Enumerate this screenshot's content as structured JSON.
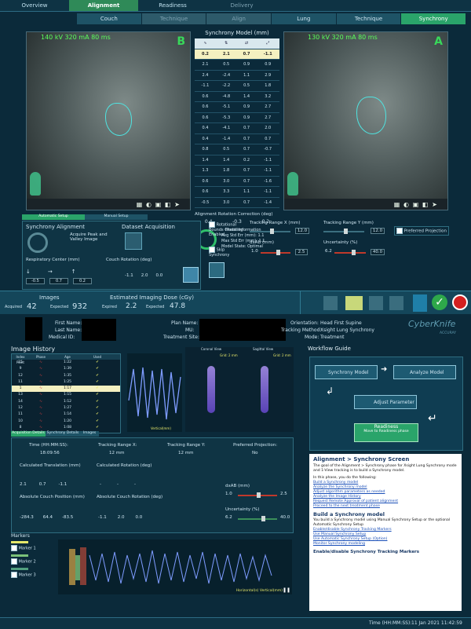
{
  "top_tabs": [
    "Overview",
    "Alignment",
    "Readiness",
    "Delivery"
  ],
  "sub_tabs": [
    "Couch",
    "Technique",
    "Align",
    "Lung",
    "Technique",
    "Synchrony"
  ],
  "left_xray": {
    "label": "140 kV 320 mA 80 ms",
    "cam": "B"
  },
  "right_xray": {
    "label": "130 kV 320 mA 80 ms",
    "cam": "A"
  },
  "sync_model": {
    "title": "Synchrony Model (mm)",
    "header": [
      "0.2",
      "2.1",
      "0.7",
      "-1.1"
    ],
    "rows": [
      [
        "2.1",
        "0.5",
        "0.9",
        "0.9"
      ],
      [
        "2.4",
        "-2.4",
        "1.1",
        "2.9"
      ],
      [
        "-1.1",
        "-2.2",
        "0.5",
        "1.8"
      ],
      [
        "0.6",
        "-4.8",
        "1.4",
        "3.2"
      ],
      [
        "0.6",
        "-5.1",
        "0.9",
        "2.7"
      ],
      [
        "0.6",
        "-5.3",
        "0.9",
        "2.7"
      ],
      [
        "0.4",
        "-4.1",
        "0.7",
        "2.0"
      ],
      [
        "0.4",
        "-1.4",
        "0.7",
        "0.7"
      ],
      [
        "0.8",
        "0.5",
        "0.7",
        "-0.7"
      ],
      [
        "1.4",
        "1.4",
        "0.2",
        "-1.1"
      ],
      [
        "1.3",
        "1.8",
        "0.7",
        "-1.1"
      ],
      [
        "0.6",
        "3.0",
        "0.7",
        "-1.6"
      ],
      [
        "0.6",
        "3.3",
        "1.1",
        "-1.1"
      ],
      [
        "-0.5",
        "3.0",
        "0.7",
        "-1.4"
      ]
    ],
    "rot_title": "Alignment Rotation Correction (deg)",
    "rot": [
      "0.4",
      "-0.3",
      "0.2"
    ],
    "mi_title": "Model Information",
    "mi": [
      [
        "Avg Std Err (mm):",
        "1.1"
      ],
      [
        "Max Std Err (mm):",
        "1.1"
      ],
      [
        "Model State:",
        "Optimal"
      ]
    ]
  },
  "setup_tabs": [
    "Automatic Setup",
    "Manual Setup"
  ],
  "sync_align": {
    "title": "Synchrony Alignment",
    "desc": "Acquire Peak and Valley Image"
  },
  "dataset": {
    "title": "Dataset Acquisition"
  },
  "resp_center": {
    "title": "Respiratory Center (mm)",
    "vals": [
      "-0.5",
      "0.7",
      "0.2"
    ]
  },
  "couch_rot": {
    "title": "Couch Rotation (deg)",
    "vals": [
      "-1.1",
      "2.0",
      "0.0"
    ]
  },
  "checks": {
    "rot_bounds": "Rotational Bounds Checking Enabled",
    "skip_sync": "Skip Synchrony"
  },
  "tracking": {
    "x_label": "Tracking Range X (mm)",
    "x_val": "12.0",
    "y_label": "Tracking Range Y (mm)",
    "y_val": "12.0",
    "pref": "Preferred Projection",
    "dxab": "dxAB (mm)",
    "dxab_min": "1.0",
    "dxab_val": "2.5",
    "unc": "Uncertainty (%)",
    "unc_min": "6.2",
    "unc_val": "40.0"
  },
  "images": {
    "title": "Images",
    "acq_label": "Acquired",
    "acq": "42",
    "exp_label": "Expected",
    "exp": "932"
  },
  "dose": {
    "title": "Estimated Imaging Dose (cGy)",
    "exp1_label": "Expired",
    "exp1": "2.2",
    "exp2_label": "Expected",
    "exp2": "47.8"
  },
  "patient": {
    "first": "First Name:",
    "last": "Last Name:",
    "mid": "Medical ID:",
    "plan": "Plan Name:",
    "mu": "MU:",
    "site": "Treatment Site:",
    "orient_l": "Orientation:",
    "orient": "Head First Supine",
    "track_l": "Tracking Method:",
    "track": "Xsight Lung Synchrony",
    "mode_l": "Mode:",
    "mode": "Treatment",
    "brand": "CyberKnife",
    "brand_sub": "ACCURAY"
  },
  "history": {
    "title": "Image History",
    "cols": [
      "Index Point",
      "Phase",
      "Age",
      "Used"
    ],
    "rows": [
      [
        "15",
        "1:22"
      ],
      [
        "9",
        "1:39"
      ],
      [
        "12",
        "1:35"
      ],
      [
        "11",
        "1:25"
      ],
      [
        "1",
        "1:17"
      ],
      [
        "13",
        "1:15"
      ],
      [
        "14",
        "1:12"
      ],
      [
        "12",
        "1:27"
      ],
      [
        "11",
        "1:14"
      ],
      [
        "10",
        "1:20"
      ],
      [
        "8",
        "1:08"
      ]
    ],
    "cor": "Coronal View",
    "sag": "Sagittal View",
    "grid1": "Grid: 2 mm",
    "grid2": "Grid: 2 mm",
    "vert": "Vertical(mm)"
  },
  "detail_tabs": [
    "Acquisition Details",
    "Synchrony Details",
    "Images"
  ],
  "details": {
    "time_l": "Time (HH:MM:SS):",
    "time": "18:09:56",
    "tx_l": "Tracking Range X:",
    "tx": "12 mm",
    "ty_l": "Tracking Range Y:",
    "ty": "12 mm",
    "pp_l": "Preferred Projection:",
    "pp": "No",
    "ct_l": "Calculated Translation (mm)",
    "ct": [
      "2.1",
      "0.7",
      "-1.1"
    ],
    "cr_l": "Calculated Rotation (deg)",
    "cr": [
      "-",
      "-",
      "-"
    ],
    "act_l": "Absolute Couch Position (mm)",
    "act": [
      "-284.3",
      "64.4",
      "-83.5"
    ],
    "acr_l": "Absolute Couch Rotation (deg)",
    "acr": [
      "-1.1",
      "2.0",
      "0.0"
    ],
    "dxab_l": "dxAB (mm)",
    "dxab1": "1.0",
    "dxab2": "2.5",
    "unc_l": "Uncertainty (%)",
    "unc1": "6.2",
    "unc2": "40.0"
  },
  "markers": {
    "title": "Markers",
    "items": [
      "Marker 1",
      "Marker 2",
      "Marker 3"
    ],
    "axis": "Horizontal(s) Vertical(mm)"
  },
  "workflow": {
    "title": "Workflow Guide",
    "sync": "Synchrony Model",
    "analyze": "Analyze Model",
    "adjust": "Adjust Parameter",
    "ready": "Readiness",
    "ready_sub": "Move to Readiness phase"
  },
  "help": {
    "title": "Alignment > Synchrony Screen",
    "p1": "The goal of the Alignment > Synchrony phase for Xsight Lung Synchrony mode and 1-View tracking is to build a Synchrony model.",
    "p2": "In this phase, you do the following:",
    "links": [
      "Build a Synchrony model",
      "Analyze the Synchrony model",
      "Adjust algorithm parameters as needed",
      "Analyze the Image History",
      "Request Remote Approval of patient alignment",
      "Proceed to the next treatment phase"
    ],
    "h2": "Build a Synchrony model",
    "p3": "You build a Synchrony model using Manual Synchrony Setup or the optional Automatic Synchrony Setup",
    "links2": [
      "Enable/disable Synchrony Tracking Markers",
      "Use Manual Synchrony Setup",
      "Use Automatic Synchrony Setup (Option)",
      "Monitor Synchrony modeling"
    ],
    "h3": "Enable/disable Synchrony Tracking Markers"
  },
  "footer": {
    "time_l": "Time (HH:MM:SS):",
    "time": "11 Jan 2021 11:42:59"
  }
}
